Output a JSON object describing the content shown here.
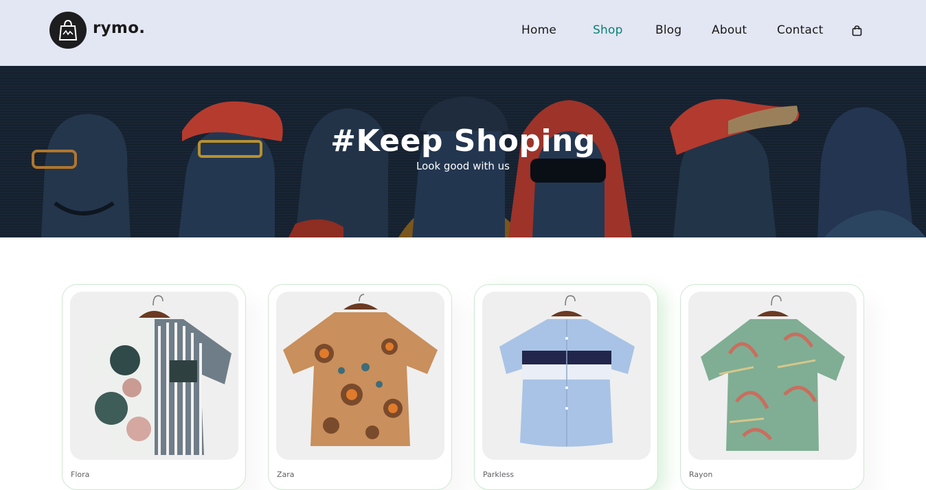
{
  "header": {
    "brand": "rymo.",
    "nav": [
      {
        "label": "Home",
        "active": false
      },
      {
        "label": "Shop",
        "active": true
      },
      {
        "label": "Blog",
        "active": false
      },
      {
        "label": "About",
        "active": false
      },
      {
        "label": "Contact",
        "active": false
      }
    ],
    "cart_icon": "shopping-bag-icon"
  },
  "hero": {
    "title": "#Keep Shoping",
    "subtitle": "Look good with us"
  },
  "products": [
    {
      "brand": "Flora",
      "pattern": "tropical-stripe-shirt"
    },
    {
      "brand": "Zara",
      "pattern": "paisley-shirt"
    },
    {
      "brand": "Parkless",
      "pattern": "blue-colorblock-shirt"
    },
    {
      "brand": "Rayon",
      "pattern": "green-floral-shirt"
    }
  ],
  "colors": {
    "header_bg": "#e3e6f3",
    "accent": "#088178",
    "card_border": "#cce7d0",
    "hero_bg": "#14202f"
  }
}
